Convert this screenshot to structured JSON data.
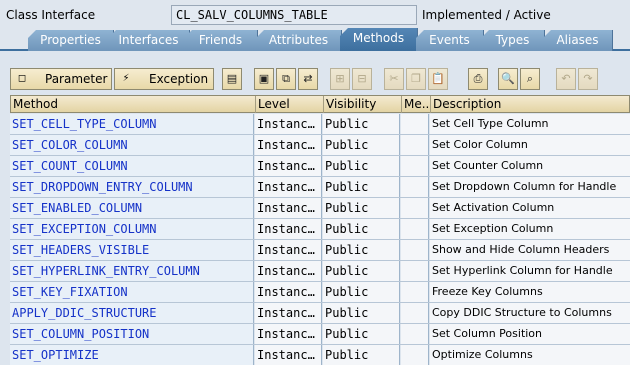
{
  "header": {
    "label": "Class Interface",
    "class_name": "CL_SALV_COLUMNS_TABLE",
    "status": "Implemented / Active"
  },
  "tabs": [
    {
      "label": "Properties",
      "active": false
    },
    {
      "label": "Interfaces",
      "active": false
    },
    {
      "label": "Friends",
      "active": false
    },
    {
      "label": "Attributes",
      "active": false
    },
    {
      "label": "Methods",
      "active": true
    },
    {
      "label": "Events",
      "active": false
    },
    {
      "label": "Types",
      "active": false
    },
    {
      "label": "Aliases",
      "active": false
    }
  ],
  "toolbar": {
    "parameter_label": "Parameter",
    "exception_label": "Exception",
    "icons": [
      "source-code-icon",
      "display-object-icon",
      "copy-object-icon",
      "navigate-icon",
      "insert-row-icon",
      "delete-row-icon",
      "cut-icon",
      "copy-icon",
      "paste-icon",
      "print-icon",
      "find-icon",
      "find-next-icon",
      "undo-icon",
      "redo-icon"
    ]
  },
  "grid": {
    "columns": [
      "Method",
      "Level",
      "Visibility",
      "Me...",
      "Description"
    ],
    "rows": [
      {
        "method": "SET_CELL_TYPE_COLUMN",
        "level": "Instanc…",
        "visibility": "Public",
        "me": "",
        "description": "Set Cell Type Column"
      },
      {
        "method": "SET_COLOR_COLUMN",
        "level": "Instanc…",
        "visibility": "Public",
        "me": "",
        "description": "Set Color Column"
      },
      {
        "method": "SET_COUNT_COLUMN",
        "level": "Instanc…",
        "visibility": "Public",
        "me": "",
        "description": "Set Counter Column"
      },
      {
        "method": "SET_DROPDOWN_ENTRY_COLUMN",
        "level": "Instanc…",
        "visibility": "Public",
        "me": "",
        "description": "Set Dropdown Column for Handle"
      },
      {
        "method": "SET_ENABLED_COLUMN",
        "level": "Instanc…",
        "visibility": "Public",
        "me": "",
        "description": "Set Activation Column"
      },
      {
        "method": "SET_EXCEPTION_COLUMN",
        "level": "Instanc…",
        "visibility": "Public",
        "me": "",
        "description": "Set Exception Column"
      },
      {
        "method": "SET_HEADERS_VISIBLE",
        "level": "Instanc…",
        "visibility": "Public",
        "me": "",
        "description": "Show and Hide Column Headers"
      },
      {
        "method": "SET_HYPERLINK_ENTRY_COLUMN",
        "level": "Instanc…",
        "visibility": "Public",
        "me": "",
        "description": "Set Hyperlink Column for Handle"
      },
      {
        "method": "SET_KEY_FIXATION",
        "level": "Instanc…",
        "visibility": "Public",
        "me": "",
        "description": "Freeze Key Columns"
      },
      {
        "method": "APPLY_DDIC_STRUCTURE",
        "level": "Instanc…",
        "visibility": "Public",
        "me": "",
        "description": "Copy DDIC Structure to Columns"
      },
      {
        "method": "SET_COLUMN_POSITION",
        "level": "Instanc…",
        "visibility": "Public",
        "me": "",
        "description": "Set Column Position"
      },
      {
        "method": "SET_OPTIMIZE",
        "level": "Instanc…",
        "visibility": "Public",
        "me": "",
        "description": "Optimize Columns"
      }
    ]
  },
  "colors": {
    "tab_active": "#3d6f9e",
    "tab_inactive": "#7fa4c7",
    "method_text": "#1532c8",
    "toolbar_button": "#efe3bc"
  }
}
